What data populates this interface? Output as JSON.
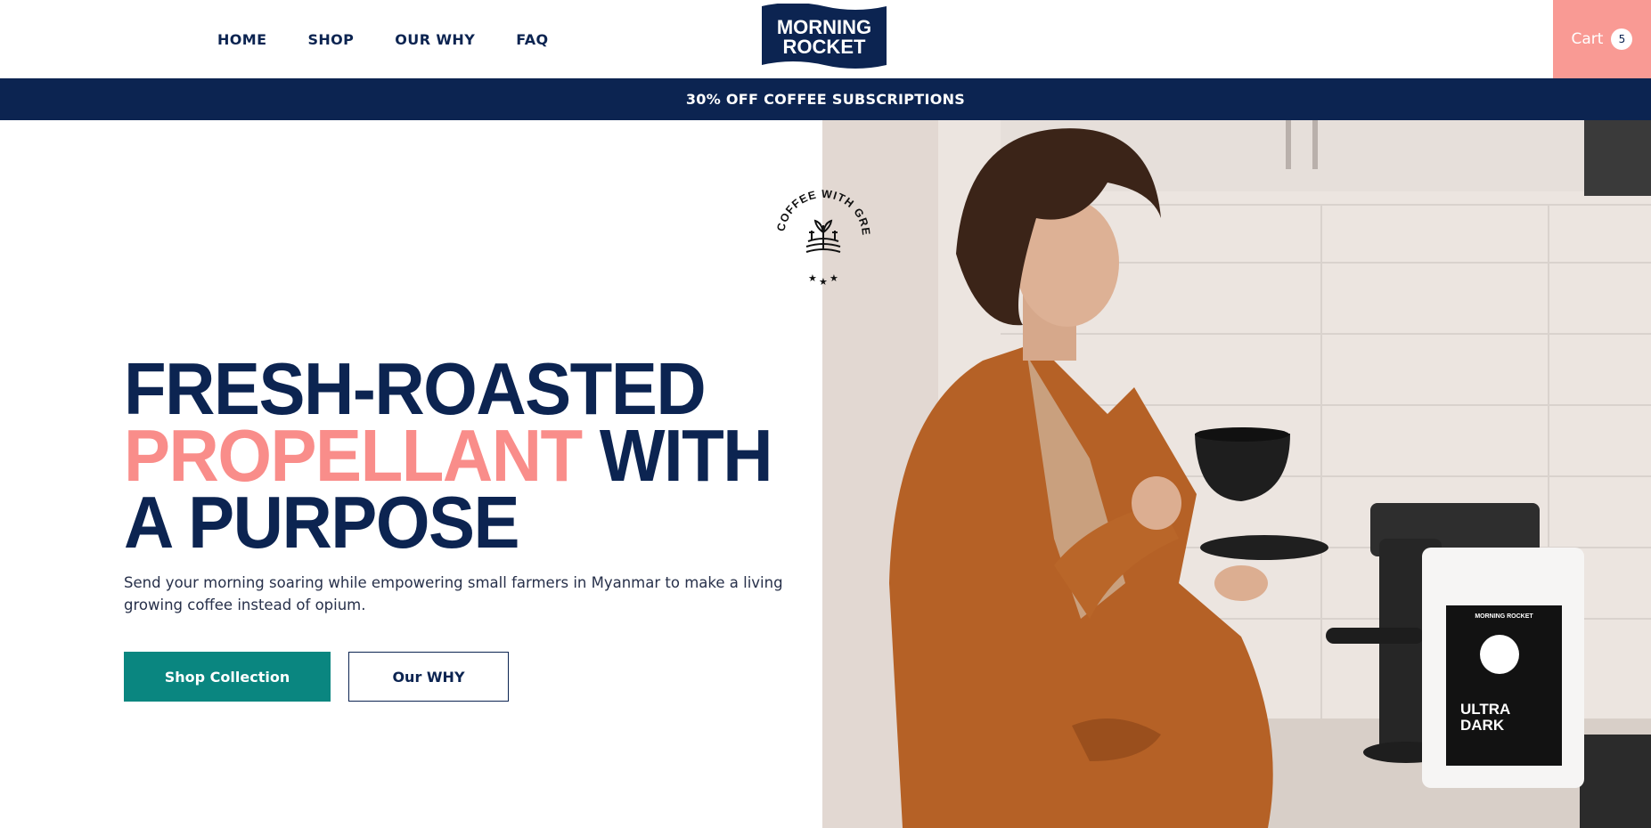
{
  "header": {
    "nav": [
      {
        "label": "HOME"
      },
      {
        "label": "SHOP"
      },
      {
        "label": "OUR WHY"
      },
      {
        "label": "FAQ"
      }
    ],
    "logo": {
      "line1": "MORNING",
      "line2": "ROCKET"
    },
    "cart": {
      "label": "Cart",
      "count": "5"
    }
  },
  "promo": {
    "text": "30% OFF COFFEE SUBSCRIPTIONS"
  },
  "hero": {
    "headline": {
      "line1": "FRESH-ROASTED",
      "line2_highlight": "PROPELLANT",
      "line2_rest": " WITH",
      "line3": "A PURPOSE"
    },
    "subtext": "Send your morning soaring while empowering small farmers in Myanmar to make a living growing coffee instead of opium.",
    "buttons": {
      "primary": "Shop Collection",
      "secondary": "Our WHY"
    },
    "badge_text": "COFFEE WITH GREAT SOCIAL CAUSES",
    "product_bag": {
      "brand": "MORNING ROCKET",
      "name_line1": "ULTRA",
      "name_line2": "DARK"
    }
  },
  "colors": {
    "navy": "#0c2451",
    "pink": "#f98d8a",
    "cart_bg": "#f99a94",
    "teal": "#0a8680"
  }
}
